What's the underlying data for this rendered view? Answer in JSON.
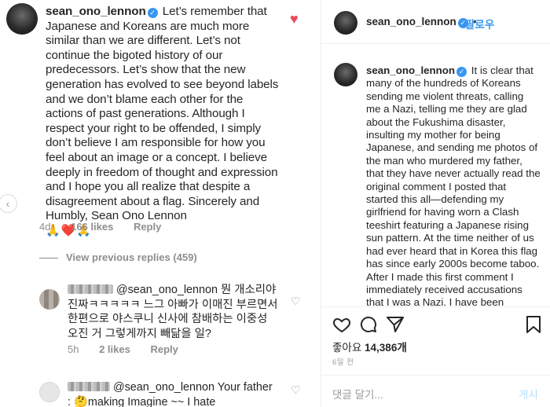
{
  "main_comment": {
    "username": "sean_ono_lennon",
    "text": "Let’s remember that Japanese and Koreans are much more similar than we are different. Let’s not continue the bigoted history of our predecessors. Let’s show that the new generation has evolved to see beyond labels and we don’t blame each other for the actions of past generations. Although I respect your right to be offended, I simply don’t believe I am responsible for how you feel about an image or a concept. I believe deeply in freedom of thought and expression and I hope you all realize that despite a disagreement about a flag. Sincerely and Humbly, Sean Ono Lennon",
    "emojis": "🙏❤️🙏",
    "age": "4d",
    "likes": "166 likes",
    "reply_label": "Reply"
  },
  "view_previous": "View previous replies (459)",
  "reply_1": {
    "mention": "@sean_ono_lennon",
    "text": "뭔 개소리야 진짜ㅋㅋㅋㅋㅋ 느그 아빠가 이매진 부르면서 한편으로 야스쿠니 신사에 참배하는 이중성 오진 거 그렇게까지 빼닮을 일?",
    "age": "5h",
    "likes": "2 likes",
    "reply_label": "Reply"
  },
  "reply_2": {
    "mention": "@sean_ono_lennon",
    "text_a": "Your father :",
    "emoji": "🤔",
    "text_b": "making Imagine ~~ I hate"
  },
  "post": {
    "username": "sean_ono_lennon",
    "follow_label": "팔로우",
    "caption_username": "sean_ono_lennon",
    "caption": "It is clear that many of the hundreds of Koreans sending me violent threats, calling me a Nazi, telling me they are glad about the Fukushima disaster, insulting my mother for being Japanese, and sending me photos of the man who murdered my father, that they have never actually read the original comment I posted that started this all—defending my girlfriend for having worn a Clash teeshirt featuring a Japanese rising sun pattern. At the time neither of us had ever heard that in Korea this flag has since early 2000s become taboo. After I made this first comment I immediately received accusations that I was a Nazi. I have been defending myself ever since. I believe when you read my original",
    "likes_label": "좋아요",
    "likes_count": "14,386개",
    "time_ago": "6일 전",
    "comment_placeholder": "댓글 달기...",
    "post_button": "게시"
  },
  "colors": {
    "link_blue": "#3897f0",
    "like_red": "#ed4956",
    "muted_gray": "#8e8e8e"
  },
  "icons": [
    "heart-icon",
    "comment-icon",
    "share-icon",
    "bookmark-icon",
    "verified-badge-icon",
    "chevron-left-icon"
  ]
}
